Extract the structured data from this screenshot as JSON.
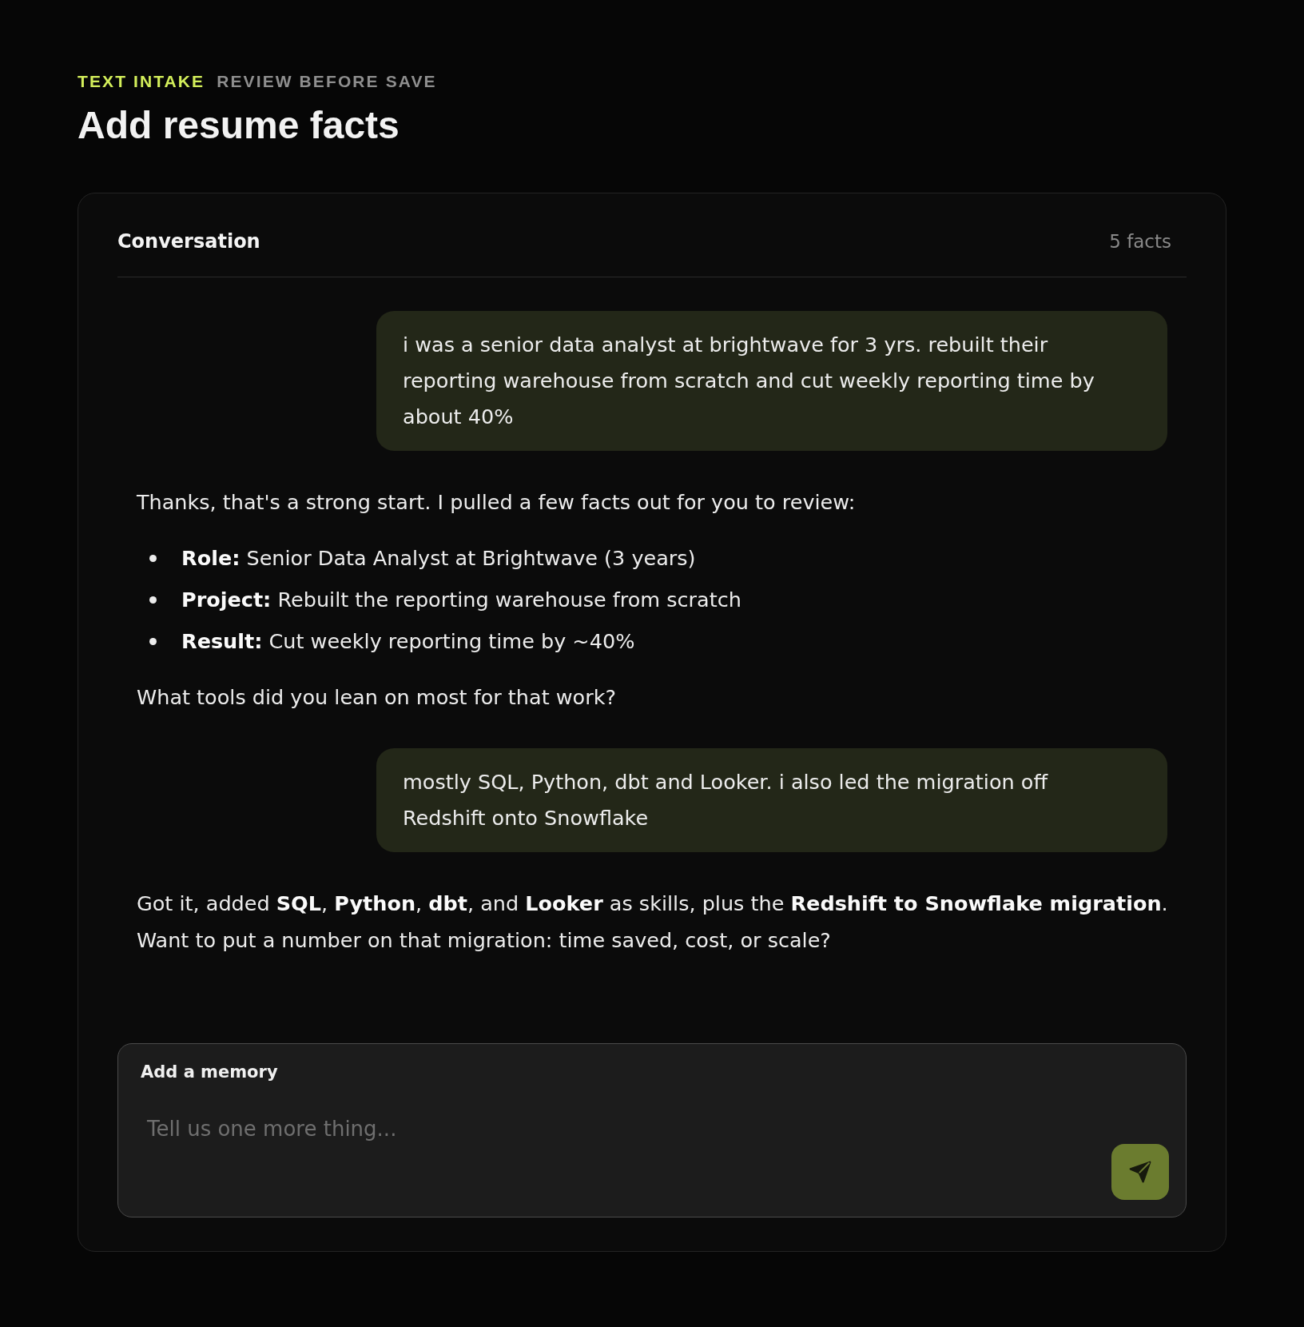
{
  "eyebrow": {
    "category": "TEXT INTAKE",
    "note": "REVIEW BEFORE SAVE"
  },
  "page_title": "Add resume facts",
  "conversation": {
    "title": "Conversation",
    "fact_count": "5 facts",
    "messages": [
      {
        "kind": "user",
        "text": "i was a senior data analyst at brightwave for 3 yrs. rebuilt their reporting warehouse from scratch and cut weekly reporting time by about 40%"
      },
      {
        "kind": "assistant",
        "blocks": [
          {
            "kind": "paragraph",
            "text": "Thanks, that's a strong start. I pulled a few facts out for you to review:"
          },
          {
            "kind": "list",
            "items": [
              "**Role:** Senior Data Analyst at Brightwave (3 years)",
              "**Project:** Rebuilt the reporting warehouse from scratch",
              "**Result:** Cut weekly reporting time by ~40%"
            ]
          },
          {
            "kind": "paragraph",
            "text": "What tools did you lean on most for that work?"
          }
        ]
      },
      {
        "kind": "user",
        "text": "mostly SQL, Python, dbt and Looker. i also led the migration off Redshift onto Snowflake"
      },
      {
        "kind": "assistant",
        "blocks": [
          {
            "kind": "paragraph",
            "text": "Got it, added **SQL**, **Python**, **dbt**, and **Looker** as skills, plus the **Redshift to Snowflake migration**. Want to put a number on that migration: time saved, cost, or scale?"
          }
        ]
      }
    ]
  },
  "composer": {
    "label": "Add a memory",
    "placeholder": "Tell us one more thing..."
  }
}
